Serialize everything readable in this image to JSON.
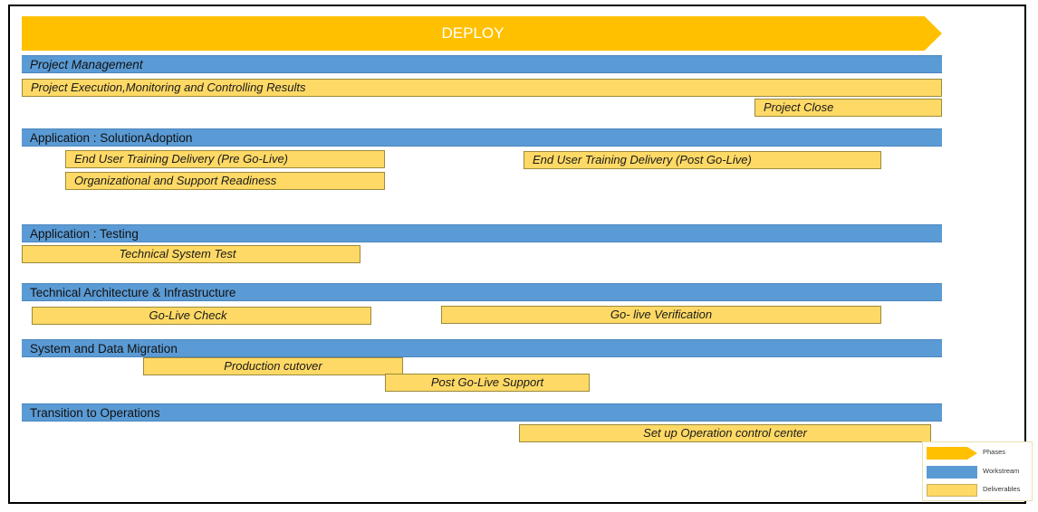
{
  "phase": {
    "label": "DEPLOY"
  },
  "workstreams": {
    "project_management": "Project Management",
    "solution_adoption": "Application : SolutionAdoption",
    "testing": "Application : Testing",
    "tech_arch": "Technical  Architecture & Infrastructure",
    "data_migration": "System and Data Migration",
    "transition": "Transition to Operations"
  },
  "deliverables": {
    "project_execution": "Project Execution,Monitoring and Controlling Results",
    "project_close": "Project Close",
    "eut_pre": "End User Training Delivery (Pre Go-Live)",
    "eut_post": "End User Training Delivery (Post Go-Live)",
    "org_readiness": "Organizational and Support Readiness",
    "tech_system_test": "Technical System Test",
    "go_live_check": "Go-Live Check",
    "go_live_verification": "Go- live Verification",
    "production_cutover": "Production cutover",
    "post_go_live_support": "Post Go-Live Support",
    "operation_control_center": "Set up Operation control center"
  },
  "legend": {
    "phases": "Phases",
    "workstream": "Workstream",
    "deliverables": "Deliverables"
  },
  "colors": {
    "phase": "#FFC000",
    "workstream": "#5B9BD5",
    "deliverable": "#FFD966"
  }
}
